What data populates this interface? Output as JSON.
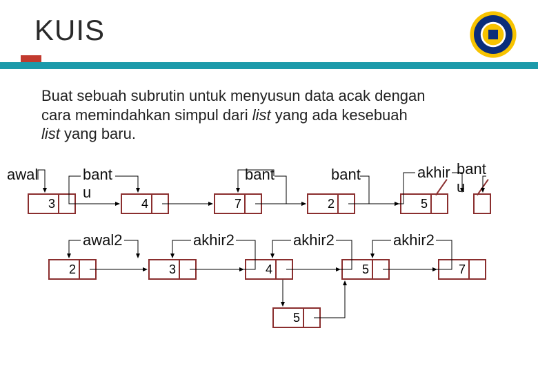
{
  "title": "KUIS",
  "body": {
    "line1": "Buat sebuah subrutin untuk menyusun data acak dengan",
    "line2_a": "cara memindahkan simpul dari ",
    "line2_b": "list",
    "line2_c": " yang ada kesebuah",
    "line3_a": "list",
    "line3_b": " yang baru."
  },
  "labels": {
    "awal": "awal",
    "bantu1": "bant\nu",
    "bantu2": "bant",
    "bantu3": "bant",
    "akhir": "akhir",
    "bantu4": "bant\nu",
    "awal2": "awal2",
    "akhir2a": "akhir2",
    "akhir2b": "akhir2",
    "akhir2c": "akhir2"
  },
  "row1": {
    "n1": "3",
    "n2": "4",
    "n3": "7",
    "n4": "2",
    "n5": "5"
  },
  "row2": {
    "n1": "2",
    "n2": "3",
    "n3": "4",
    "n4": "5",
    "n5": "7"
  },
  "extra": {
    "n": "5"
  },
  "logo": {
    "ring1": "#f7c300",
    "ring2": "#0a2d7a",
    "center": "#ffffff"
  }
}
